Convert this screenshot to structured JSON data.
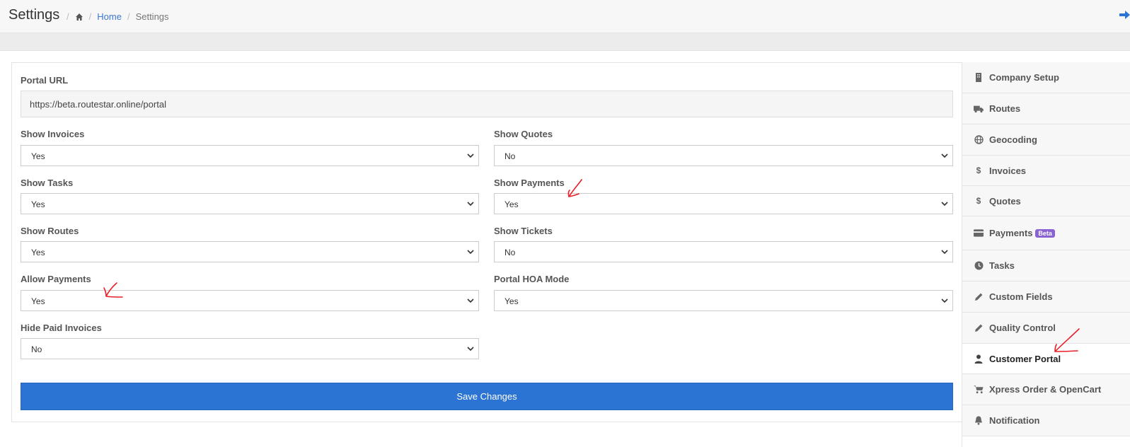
{
  "header": {
    "title": "Settings",
    "breadcrumb": {
      "home": "Home",
      "current": "Settings"
    }
  },
  "form": {
    "portal_url": {
      "label": "Portal URL",
      "value": "https://beta.routestar.online/portal"
    },
    "show_invoices": {
      "label": "Show Invoices",
      "value": "Yes"
    },
    "show_quotes": {
      "label": "Show Quotes",
      "value": "No"
    },
    "show_tasks": {
      "label": "Show Tasks",
      "value": "Yes"
    },
    "show_payments": {
      "label": "Show Payments",
      "value": "Yes"
    },
    "show_routes": {
      "label": "Show Routes",
      "value": "Yes"
    },
    "show_tickets": {
      "label": "Show Tickets",
      "value": "No"
    },
    "allow_payments": {
      "label": "Allow Payments",
      "value": "Yes"
    },
    "portal_hoa_mode": {
      "label": "Portal HOA Mode",
      "value": "Yes"
    },
    "hide_paid_invoices": {
      "label": "Hide Paid Invoices",
      "value": "No"
    },
    "save_label": "Save Changes"
  },
  "sidebar": {
    "items": [
      {
        "label": "Company Setup",
        "icon": "building-icon"
      },
      {
        "label": "Routes",
        "icon": "truck-icon"
      },
      {
        "label": "Geocoding",
        "icon": "globe-icon"
      },
      {
        "label": "Invoices",
        "icon": "dollar-icon"
      },
      {
        "label": "Quotes",
        "icon": "dollar-icon"
      },
      {
        "label": "Payments",
        "icon": "credit-card-icon",
        "badge": "Beta"
      },
      {
        "label": "Tasks",
        "icon": "clock-icon"
      },
      {
        "label": "Custom Fields",
        "icon": "pencil-icon"
      },
      {
        "label": "Quality Control",
        "icon": "pencil-icon"
      },
      {
        "label": "Customer Portal",
        "icon": "user-icon",
        "active": true
      },
      {
        "label": "Xpress Order & OpenCart",
        "icon": "cart-icon"
      },
      {
        "label": "Notification",
        "icon": "bell-icon"
      }
    ]
  },
  "colors": {
    "primary": "#2b74d4",
    "beta_badge": "#8a63d2",
    "annotation": "#e8202a"
  }
}
